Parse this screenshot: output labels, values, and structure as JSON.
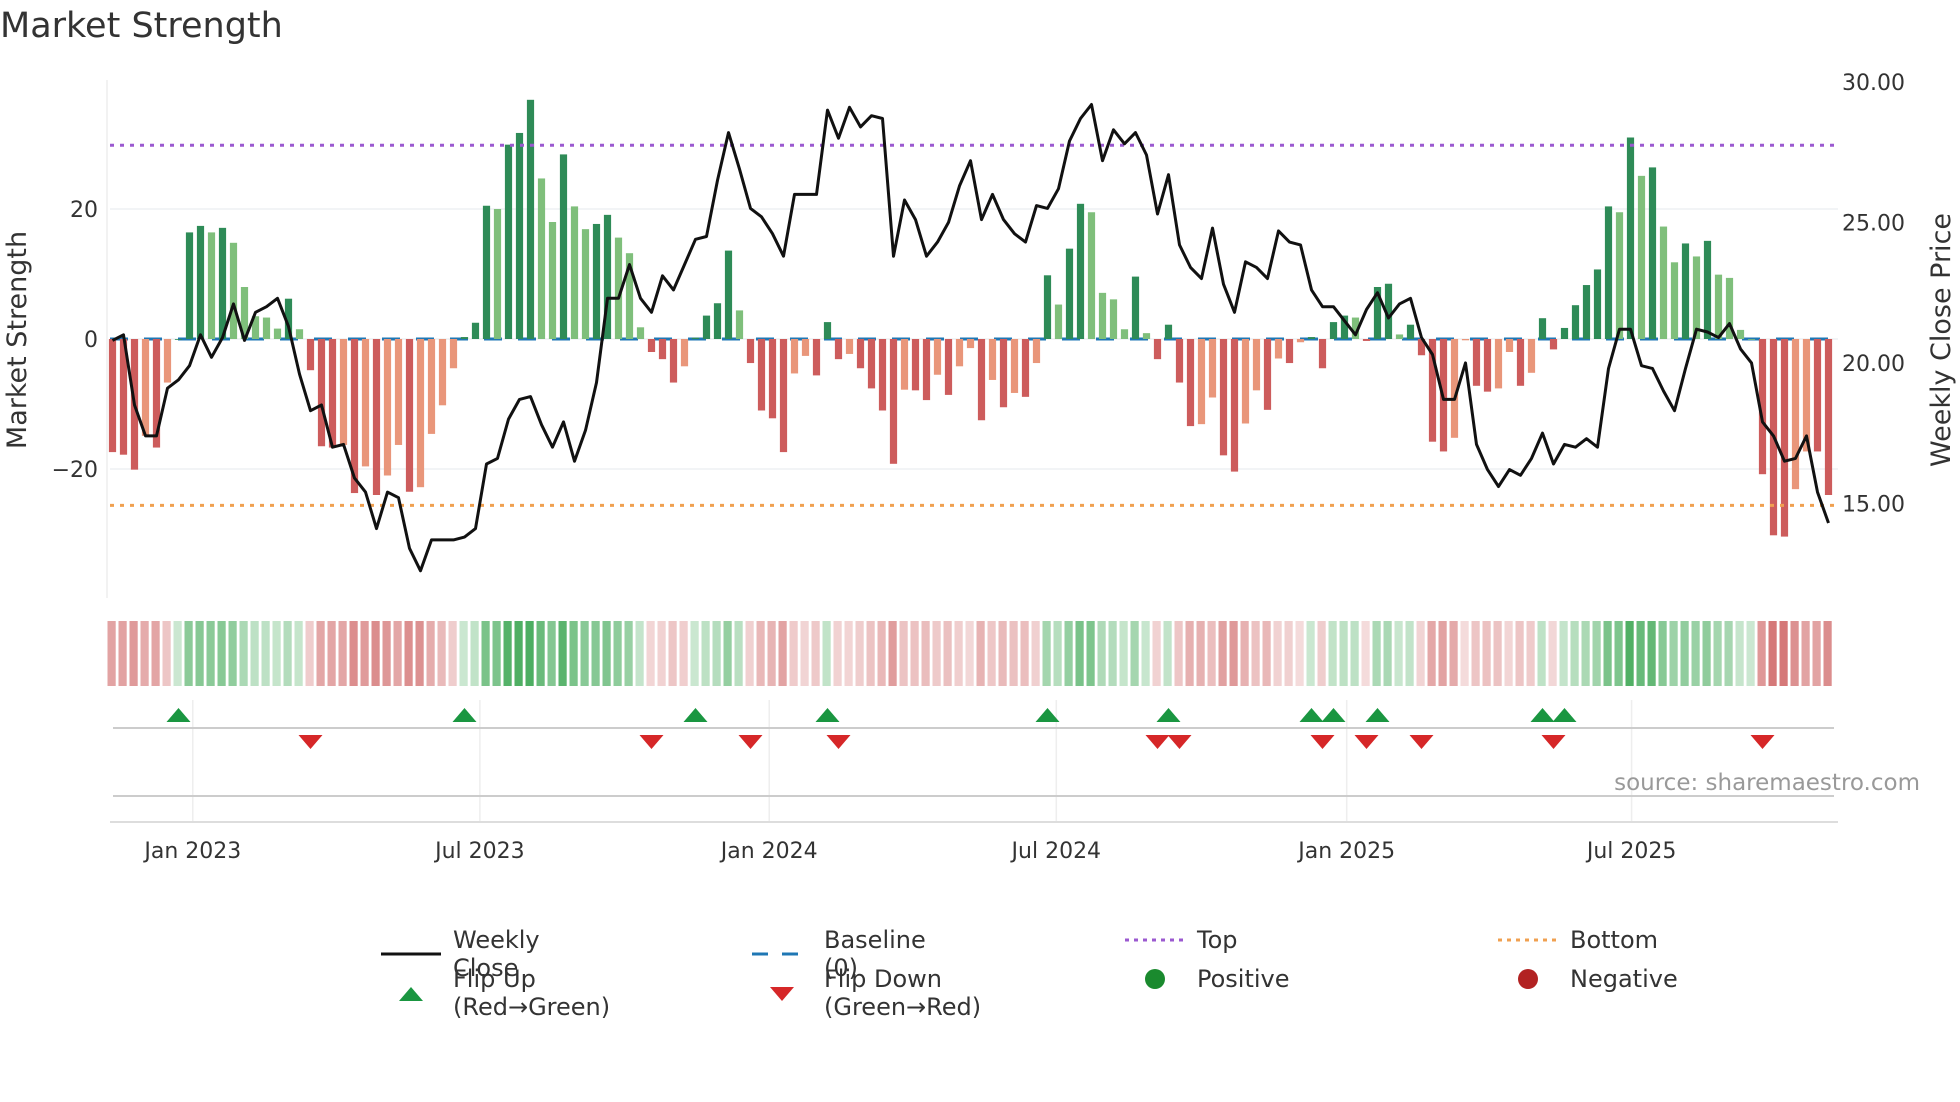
{
  "title": "Market Strength",
  "source": "source: sharemaestro.com",
  "chart_data": {
    "type": "bar",
    "title": "Market Strength",
    "ylabel": "Market Strength",
    "y2label": "Weekly Close Price",
    "ylim": [
      -40,
      39
    ],
    "y2lim": [
      11,
      30.6
    ],
    "yticks": [
      {
        "v": 20,
        "label": "20"
      },
      {
        "v": 0,
        "label": "0"
      },
      {
        "v": -20,
        "label": "−20"
      }
    ],
    "y2ticks": [
      {
        "v": 30,
        "label": "30.00"
      },
      {
        "v": 25,
        "label": "25.00"
      },
      {
        "v": 20,
        "label": "20.00"
      },
      {
        "v": 15,
        "label": "15.00"
      }
    ],
    "xticks": [
      {
        "week": 7.3,
        "label": "Jan 2023"
      },
      {
        "week": 33.4,
        "label": "Jul 2023"
      },
      {
        "week": 59.7,
        "label": "Jan 2024"
      },
      {
        "week": 85.8,
        "label": "Jul 2024"
      },
      {
        "week": 112.2,
        "label": "Jan 2025"
      },
      {
        "week": 138.1,
        "label": "Jul 2025"
      }
    ],
    "top_level": 29.8,
    "bottom_level": -25.6,
    "baseline": 0,
    "strength": [
      -17.4,
      -17.8,
      -20.1,
      -14.9,
      -16.7,
      -6.7,
      0,
      16.4,
      17.4,
      16.4,
      17.1,
      14.8,
      8.0,
      3.5,
      3.3,
      1.6,
      6.2,
      1.5,
      -4.8,
      -16.5,
      -16.7,
      -16.3,
      -23.7,
      -19.6,
      -24,
      -21,
      -16.3,
      -23.5,
      -22.8,
      -14.6,
      -10.2,
      -4.5,
      0.3,
      2.5,
      20.5,
      20,
      29.9,
      31.7,
      36.8,
      24.7,
      18,
      28.4,
      20.4,
      16.9,
      17.7,
      19.1,
      15.6,
      13.2,
      1.8,
      -2,
      -3.1,
      -6.7,
      -4.2,
      0.2,
      3.6,
      5.5,
      13.6,
      4.4,
      -3.7,
      -11,
      -12.2,
      -17.4,
      -5.3,
      -2.6,
      -5.6,
      2.6,
      -3.1,
      -2.3,
      -4.5,
      -7.6,
      -11,
      -19.2,
      -7.8,
      -7.9,
      -9.4,
      -5.5,
      -8.6,
      -4.2,
      -1.4,
      -12.5,
      -6.3,
      -10.5,
      -8.3,
      -8.9,
      -3.7,
      9.8,
      5.3,
      13.9,
      20.8,
      19.5,
      7.1,
      6.1,
      1.5,
      9.6,
      0.9,
      -3.1,
      2.2,
      -6.7,
      -13.4,
      -13.1,
      -9,
      -17.9,
      -20.4,
      -13,
      -7.9,
      -10.9,
      -3,
      -3.7,
      -0.5,
      0.3,
      -4.5,
      2.6,
      3.6,
      3.3,
      -0.3,
      8,
      8.5,
      0.7,
      2.2,
      -2.5,
      -15.8,
      -17.3,
      -15.2,
      -0.2,
      -7.2,
      -8.1,
      -7.6,
      -2,
      -7.2,
      -5.2,
      3.2,
      -1.6,
      1.7,
      5.2,
      8.3,
      10.7,
      20.4,
      19.5,
      31,
      25.1,
      26.4,
      17.3,
      11.8,
      14.7,
      12.7,
      15.1,
      9.9,
      9.4,
      1.4,
      0,
      -20.8,
      -30.2,
      -30.4,
      -23.1,
      -17.3,
      -17.3,
      -24
    ],
    "weekly_close": [
      20.8,
      21.0,
      18.5,
      17.4,
      17.4,
      19.1,
      19.4,
      19.9,
      21.0,
      20.2,
      20.9,
      22.1,
      20.8,
      21.8,
      22.0,
      22.3,
      21.3,
      19.6,
      18.3,
      18.5,
      17.0,
      17.1,
      15.9,
      15.4,
      14.1,
      15.4,
      15.2,
      13.4,
      12.6,
      13.7,
      13.7,
      13.7,
      13.8,
      14.1,
      16.4,
      16.6,
      18.0,
      18.7,
      18.8,
      17.8,
      17.0,
      17.9,
      16.5,
      17.6,
      19.3,
      22.3,
      22.3,
      23.5,
      22.3,
      21.8,
      23.1,
      22.6,
      23.5,
      24.4,
      24.5,
      26.5,
      28.2,
      26.9,
      25.5,
      25.2,
      24.6,
      23.8,
      26.0,
      26.0,
      26.0,
      29.0,
      28.0,
      29.1,
      28.4,
      28.8,
      28.7,
      23.8,
      25.8,
      25.1,
      23.8,
      24.3,
      25.0,
      26.3,
      27.2,
      25.1,
      26.0,
      25.1,
      24.6,
      24.3,
      25.6,
      25.5,
      26.2,
      27.9,
      28.7,
      29.2,
      27.2,
      28.3,
      27.8,
      28.2,
      27.4,
      25.3,
      26.7,
      24.2,
      23.4,
      23.0,
      24.8,
      22.8,
      21.8,
      23.6,
      23.4,
      23.0,
      24.7,
      24.3,
      24.2,
      22.6,
      22.0,
      22.0,
      21.5,
      21.0,
      21.9,
      22.5,
      21.6,
      22.1,
      22.3,
      20.9,
      20.3,
      18.7,
      18.7,
      20.0,
      17.1,
      16.2,
      15.6,
      16.2,
      16.0,
      16.6,
      17.5,
      16.4,
      17.1,
      17.0,
      17.3,
      17.0,
      19.8,
      21.2,
      21.2,
      19.9,
      19.8,
      19.0,
      18.3,
      19.8,
      21.2,
      21.1,
      20.9,
      21.4,
      20.5,
      20.0,
      17.9,
      17.4,
      16.5,
      16.6,
      17.4,
      15.4,
      14.3
    ],
    "flip_up_weeks": [
      6,
      32,
      53,
      65,
      85,
      96,
      109,
      111,
      115,
      130,
      132
    ],
    "flip_down_weeks": [
      18,
      49,
      58,
      66,
      95,
      97,
      110,
      114,
      119,
      131,
      150
    ],
    "legend_position": "bottom"
  },
  "legend": [
    {
      "label": "Weekly Close",
      "symbol": "line",
      "color": "#111111"
    },
    {
      "label": "Baseline (0)",
      "symbol": "dash",
      "color": "#1f77b4"
    },
    {
      "label": "Top",
      "symbol": "dot",
      "color": "#9b59d0"
    },
    {
      "label": "Bottom",
      "symbol": "dot",
      "color": "#f0a050"
    },
    {
      "label": "Flip Up (Red→Green)",
      "symbol": "tri-up",
      "color": "#1a9641"
    },
    {
      "label": "Flip Down (Green→Red)",
      "symbol": "tri-down",
      "color": "#d62728"
    },
    {
      "label": "Positive",
      "symbol": "circle",
      "color": "#1a8a2e"
    },
    {
      "label": "Negative",
      "symbol": "circle",
      "color": "#b22222"
    }
  ],
  "colors": {
    "pos_dark": "#2e8b57",
    "pos_light": "#7fbf7b",
    "neg_dark": "#cd5c5c",
    "neg_light": "#e9967a"
  }
}
